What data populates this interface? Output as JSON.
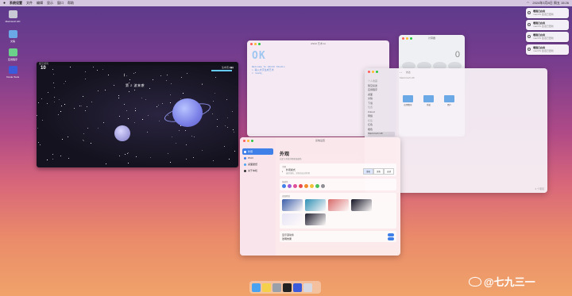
{
  "menubar": {
    "app_name": "系统设置",
    "menus": [
      "文件",
      "编辑",
      "显示",
      "窗口",
      "帮助"
    ],
    "clock": "2024年3月8日 周五 15:26"
  },
  "desktop": {
    "icons": [
      {
        "label": "Macintosh HD",
        "icon": "hard-drive-icon",
        "color": "#c9c9d6"
      },
      {
        "label": "文稿",
        "icon": "folder-icon",
        "color": "#6aa9e6"
      },
      {
        "label": "应用程序",
        "icon": "folder-icon",
        "color": "#6ad08a"
      },
      {
        "label": "Xcode Tools",
        "icon": "xcode-icon",
        "color": "#3b5bdb"
      }
    ]
  },
  "notifications": [
    {
      "title": "增强已启用",
      "subtitle": "macOS 会话已更新"
    },
    {
      "title": "增强已启用",
      "subtitle": "macOS 会话已更新"
    },
    {
      "title": "增强已启用",
      "subtitle": "macOS 会话已更新"
    },
    {
      "title": "增强已启用",
      "subtitle": "macOS 会话已更新"
    }
  ],
  "game": {
    "topbar": "星空游戏",
    "score": "10",
    "status": "第 2 波来袭",
    "hud": "生命值 ▮▮▮"
  },
  "textedit": {
    "title": "ASCII 艺术.txt",
    "ascii": "OK",
    "lines": [
      "Welcome to ASCII Studio",
      "> 输入文字生成艺术",
      "> ready_"
    ]
  },
  "calculator": {
    "title": "计算器",
    "display": "0"
  },
  "finder": {
    "title": "访达",
    "sidebar": [
      "个人收藏",
      "隔空投送",
      "应用程序",
      "桌面",
      "文稿",
      "下载",
      "位置",
      "iCloud",
      "网络",
      "标签",
      "红色",
      "橙色",
      "Macintosh HD"
    ],
    "path": "Macintosh HD",
    "folders": [
      "应用程序",
      "系统",
      "用户"
    ],
    "footer": "3 个项目"
  },
  "settings": {
    "title": "系统设置",
    "sidebar": [
      {
        "label": "外观",
        "icon": "appearance-icon"
      },
      {
        "label": "Wi-Fi",
        "icon": "wifi-icon"
      },
      {
        "label": "桌面壁纸",
        "icon": "wallpaper-icon"
      },
      {
        "label": "关于本机",
        "icon": "apple-icon"
      }
    ],
    "heading": "外观",
    "subheading": "自定义系统外观和强调色",
    "theme_card": {
      "title": "主题",
      "label": "外观模式",
      "desc": "选择浅色、深色或自动外观",
      "options": [
        "浅色",
        "深色",
        "自动"
      ]
    },
    "accent_card": {
      "title": "强调色",
      "colors": [
        "#3f7fe8",
        "#a05cd6",
        "#e0509a",
        "#e84b4b",
        "#f08a2a",
        "#f0c23a",
        "#4cc25a",
        "#8e8e93"
      ]
    },
    "wallpaper_card": {
      "title": "桌面壁纸",
      "items": [
        "#3a5ea8",
        "#2e8fb4",
        "#d86a6a",
        "#111122",
        "#e7e4f6",
        "#1e1e2e"
      ]
    },
    "toggles": [
      {
        "label": "显示滚动条",
        "on": true
      },
      {
        "label": "透明效果",
        "on": true
      }
    ]
  },
  "dock": {
    "apps": [
      {
        "name": "finder-icon",
        "color": "#4aa3f0"
      },
      {
        "name": "notes-icon",
        "color": "#f5d04a"
      },
      {
        "name": "settings-icon",
        "color": "#9aa0aa"
      },
      {
        "name": "terminal-icon",
        "color": "#222"
      },
      {
        "name": "xcode-icon",
        "color": "#3b5bdb"
      },
      {
        "name": "trash-icon",
        "color": "#d8d8e0"
      }
    ]
  },
  "watermark": "@七九三一"
}
